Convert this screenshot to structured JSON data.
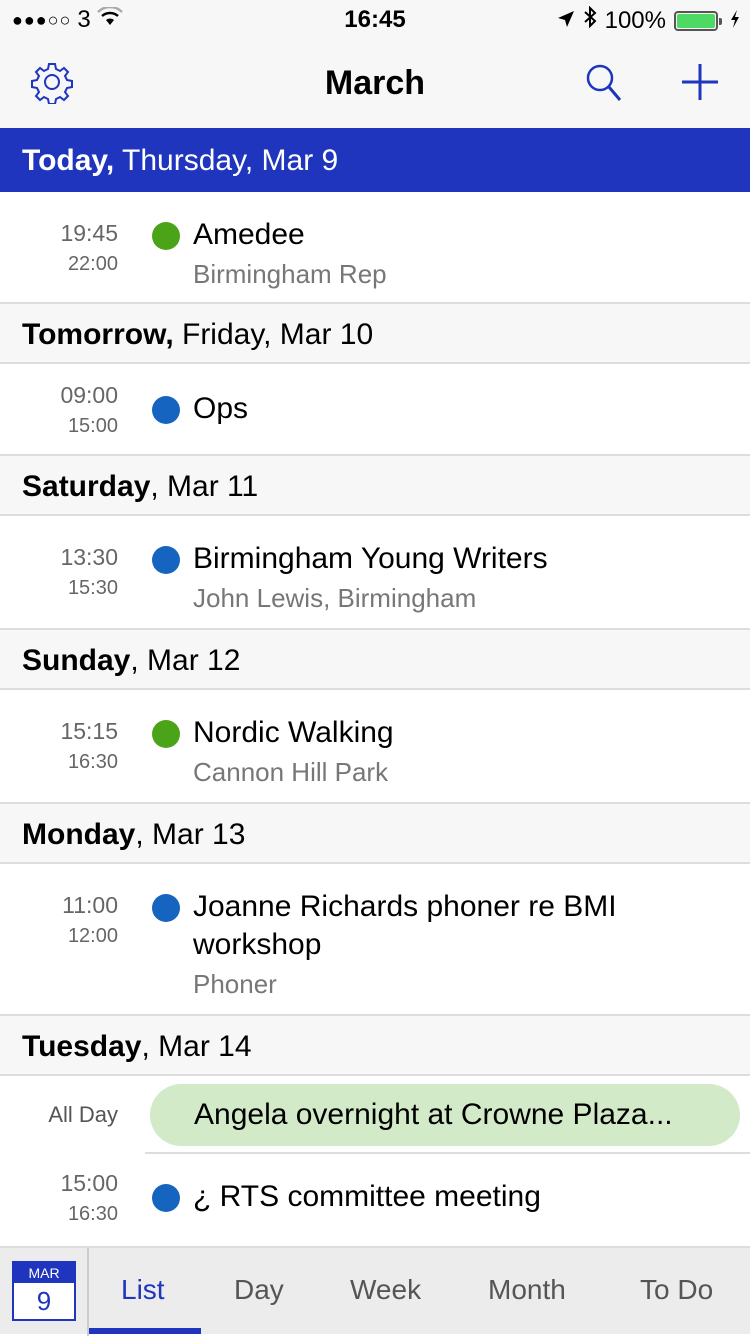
{
  "status_bar": {
    "signal": "●●●○○",
    "carrier": "3",
    "time": "16:45",
    "battery_percent": "100%",
    "battery_level": 1.0,
    "battery_color": "#4cd964"
  },
  "navbar": {
    "title": "March",
    "settings_icon": "gear-icon",
    "search_icon": "search-icon",
    "add_icon": "plus-icon",
    "accent": "#1f35bd"
  },
  "days": [
    {
      "bold": "Today,",
      "rest": " Thursday, Mar 9",
      "is_today": true,
      "events": [
        {
          "start": "19:45",
          "end": "22:00",
          "title": "Amedee",
          "location": "Birmingham Rep",
          "color": "#4ba318"
        }
      ]
    },
    {
      "bold": "Tomorrow,",
      "rest": " Friday, Mar 10",
      "events": [
        {
          "start": "09:00",
          "end": "15:00",
          "title": "Ops",
          "location": "",
          "color": "#1565c0"
        }
      ]
    },
    {
      "bold": "Saturday",
      "rest": ", Mar 11",
      "events": [
        {
          "start": "13:30",
          "end": "15:30",
          "title": "Birmingham Young Writers",
          "location": "John Lewis, Birmingham",
          "color": "#1565c0"
        }
      ]
    },
    {
      "bold": "Sunday",
      "rest": ", Mar 12",
      "events": [
        {
          "start": "15:15",
          "end": "16:30",
          "title": "Nordic Walking",
          "location": "Cannon Hill Park",
          "color": "#4ba318"
        }
      ]
    },
    {
      "bold": "Monday",
      "rest": ", Mar 13",
      "events": [
        {
          "start": "11:00",
          "end": "12:00",
          "title": "Joanne Richards phoner re BMI workshop",
          "location": "Phoner",
          "color": "#1565c0"
        }
      ]
    },
    {
      "bold": "Tuesday",
      "rest": ", Mar 14",
      "all_day": {
        "label": "All Day",
        "title": "Angela overnight at Crowne Plaza...",
        "color": "#d2eac7"
      },
      "events": [
        {
          "start": "15:00",
          "end": "16:30",
          "title": "¿ RTS committee meeting",
          "location": "",
          "color": "#1565c0"
        }
      ]
    }
  ],
  "tabbar": {
    "calendar_month": "MAR",
    "calendar_day": "9",
    "tabs": [
      {
        "label": "List",
        "active": true
      },
      {
        "label": "Day",
        "active": false
      },
      {
        "label": "Week",
        "active": false
      },
      {
        "label": "Month",
        "active": false
      },
      {
        "label": "To Do",
        "active": false
      }
    ]
  }
}
